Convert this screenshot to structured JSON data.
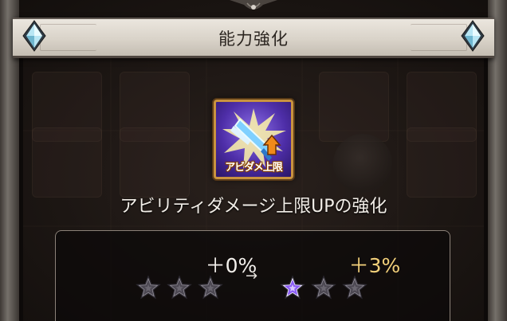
{
  "dialog": {
    "title": "能力強化"
  },
  "skill": {
    "icon_name": "ability-damage-cap-up-icon",
    "icon_label": "アビダメ上限",
    "name": "アビリティダメージ上限UPの強化"
  },
  "upgrade": {
    "current_value": "＋0%",
    "next_value": "＋3%",
    "arrow": "→",
    "current_stars_filled": 0,
    "next_stars_filled": 1,
    "max_stars": 3
  },
  "colors": {
    "next_value": "#f2d07a",
    "star_filled": "#8b5cf6",
    "icon_border": "#c9933f"
  }
}
